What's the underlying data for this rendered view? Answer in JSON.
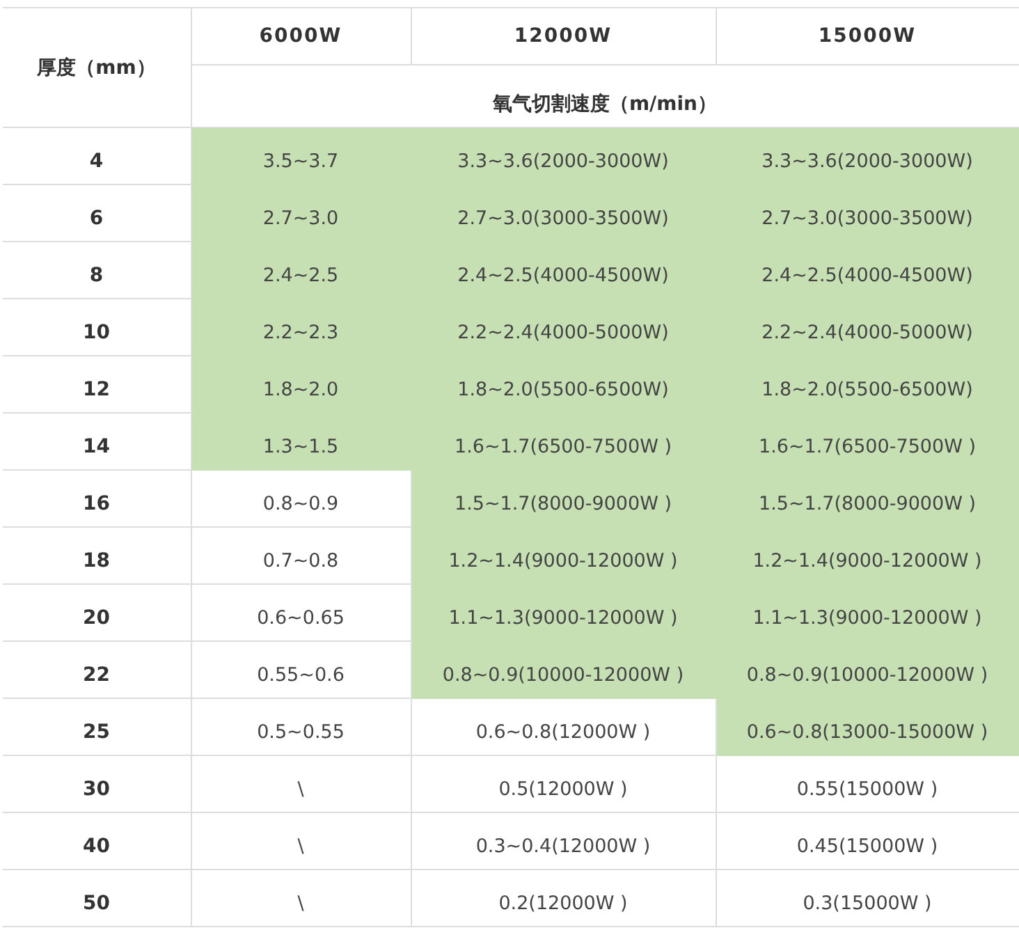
{
  "table": {
    "corner": "厚度（mm）",
    "power_columns": [
      "6000W",
      "12000W",
      "15000W"
    ],
    "speed_heading": "氧气切割速度（m/min）",
    "rows": [
      {
        "thickness": "4",
        "cells": [
          {
            "text": "3.5~3.7",
            "highlighted": true
          },
          {
            "text": "3.3~3.6(2000-3000W)",
            "highlighted": true
          },
          {
            "text": "3.3~3.6(2000-3000W)",
            "highlighted": true
          }
        ]
      },
      {
        "thickness": "6",
        "cells": [
          {
            "text": "2.7~3.0",
            "highlighted": true
          },
          {
            "text": "2.7~3.0(3000-3500W)",
            "highlighted": true
          },
          {
            "text": "2.7~3.0(3000-3500W)",
            "highlighted": true
          }
        ]
      },
      {
        "thickness": "8",
        "cells": [
          {
            "text": "2.4~2.5",
            "highlighted": true
          },
          {
            "text": "2.4~2.5(4000-4500W)",
            "highlighted": true
          },
          {
            "text": "2.4~2.5(4000-4500W)",
            "highlighted": true
          }
        ]
      },
      {
        "thickness": "10",
        "cells": [
          {
            "text": "2.2~2.3",
            "highlighted": true
          },
          {
            "text": "2.2~2.4(4000-5000W)",
            "highlighted": true
          },
          {
            "text": "2.2~2.4(4000-5000W)",
            "highlighted": true
          }
        ]
      },
      {
        "thickness": "12",
        "cells": [
          {
            "text": "1.8~2.0",
            "highlighted": true
          },
          {
            "text": "1.8~2.0(5500-6500W)",
            "highlighted": true
          },
          {
            "text": "1.8~2.0(5500-6500W)",
            "highlighted": true
          }
        ]
      },
      {
        "thickness": "14",
        "cells": [
          {
            "text": "1.3~1.5",
            "highlighted": true
          },
          {
            "text": "1.6~1.7(6500-7500W )",
            "highlighted": true
          },
          {
            "text": "1.6~1.7(6500-7500W )",
            "highlighted": true
          }
        ]
      },
      {
        "thickness": "16",
        "cells": [
          {
            "text": "0.8~0.9",
            "highlighted": false
          },
          {
            "text": "1.5~1.7(8000-9000W )",
            "highlighted": true
          },
          {
            "text": "1.5~1.7(8000-9000W )",
            "highlighted": true
          }
        ]
      },
      {
        "thickness": "18",
        "cells": [
          {
            "text": "0.7~0.8",
            "highlighted": false
          },
          {
            "text": "1.2~1.4(9000-12000W )",
            "highlighted": true
          },
          {
            "text": "1.2~1.4(9000-12000W )",
            "highlighted": true
          }
        ]
      },
      {
        "thickness": "20",
        "cells": [
          {
            "text": "0.6~0.65",
            "highlighted": false
          },
          {
            "text": "1.1~1.3(9000-12000W )",
            "highlighted": true
          },
          {
            "text": "1.1~1.3(9000-12000W )",
            "highlighted": true
          }
        ]
      },
      {
        "thickness": "22",
        "cells": [
          {
            "text": "0.55~0.6",
            "highlighted": false
          },
          {
            "text": "0.8~0.9(10000-12000W )",
            "highlighted": true
          },
          {
            "text": "0.8~0.9(10000-12000W )",
            "highlighted": true
          }
        ]
      },
      {
        "thickness": "25",
        "cells": [
          {
            "text": "0.5~0.55",
            "highlighted": false
          },
          {
            "text": "0.6~0.8(12000W )",
            "highlighted": false
          },
          {
            "text": "0.6~0.8(13000-15000W )",
            "highlighted": true
          }
        ]
      },
      {
        "thickness": "30",
        "cells": [
          {
            "text": "\\",
            "highlighted": false
          },
          {
            "text": "0.5(12000W )",
            "highlighted": false
          },
          {
            "text": "0.55(15000W )",
            "highlighted": false
          }
        ]
      },
      {
        "thickness": "40",
        "cells": [
          {
            "text": "\\",
            "highlighted": false
          },
          {
            "text": "0.3~0.4(12000W )",
            "highlighted": false
          },
          {
            "text": "0.45(15000W )",
            "highlighted": false
          }
        ]
      },
      {
        "thickness": "50",
        "cells": [
          {
            "text": "\\",
            "highlighted": false
          },
          {
            "text": "0.2(12000W )",
            "highlighted": false
          },
          {
            "text": "0.3(15000W )",
            "highlighted": false
          }
        ]
      }
    ]
  }
}
